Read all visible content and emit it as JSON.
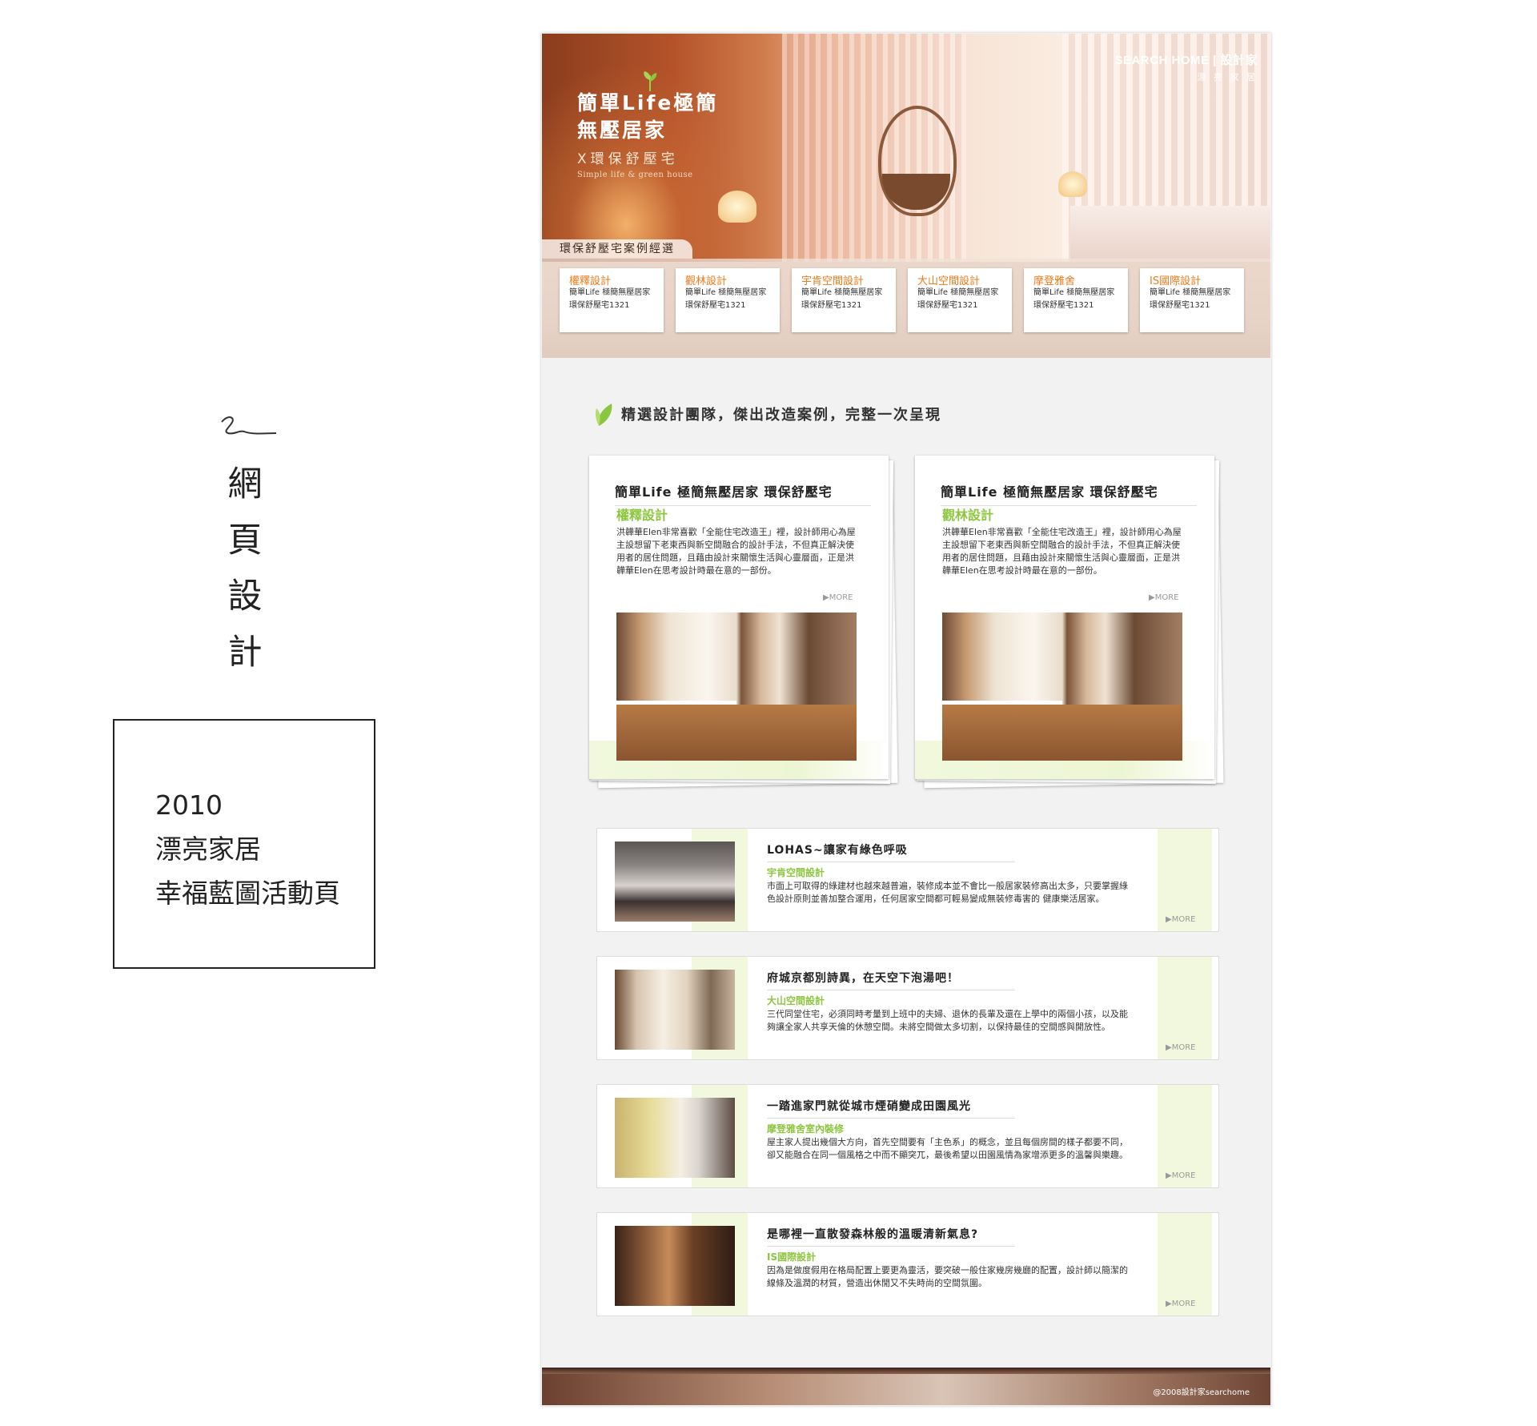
{
  "annotation": {
    "title_chars": [
      "網",
      "頁",
      "設",
      "計"
    ],
    "info_lines": [
      "2010",
      "漂亮家居",
      "幸福藍圖活動頁"
    ]
  },
  "banner": {
    "brand_line1": "SEARCH HOME | 設計家",
    "brand_line2": "漂 亮 家 居",
    "headline_line1": "簡單Life極簡",
    "headline_line2": "無壓居家",
    "headline_line3": "X環保舒壓宅",
    "headline_line4": "Simple life & green house",
    "section_tab": "環保舒壓宅案例經選"
  },
  "designers": [
    {
      "name": "權釋設計",
      "text": "簡單Life 極簡無壓居家 環保舒壓宅1321"
    },
    {
      "name": "觀林設計",
      "text": "簡單Life 極簡無壓居家 環保舒壓宅1321"
    },
    {
      "name": "宇肯空間設計",
      "text": "簡單Life 極簡無壓居家 環保舒壓宅1321"
    },
    {
      "name": "大山空間設計",
      "text": "簡單Life 極簡無壓居家 環保舒壓宅1321"
    },
    {
      "name": "摩登雅舍",
      "text": "簡單Life 極簡無壓居家 環保舒壓宅1321"
    },
    {
      "name": "IS國際設計",
      "text": "簡單Life 極簡無壓居家 環保舒壓宅1321"
    }
  ],
  "section_heading": "精選設計團隊，傑出改造案例，完整一次呈現",
  "features": [
    {
      "title": "簡單Life 極簡無壓居家 環保舒壓宅",
      "designer": "權釋設計",
      "text": "洪韡華Elen非常喜歡「全能住宅改造王」裡，設計師用心為屋主設想留下老東西與新空間融合的設計手法，不但真正解決使用者的居住問題，且藉由設計來關懷生活與心靈層面，正是洪韡華Elen在思考設計時最在意的一部份。",
      "more": "MORE"
    },
    {
      "title": "簡單Life 極簡無壓居家 環保舒壓宅",
      "designer": "觀林設計",
      "text": "洪韡華Elen非常喜歡「全能住宅改造王」裡，設計師用心為屋主設想留下老東西與新空間融合的設計手法，不但真正解決使用者的居住問題，且藉由設計來關懷生活與心靈層面，正是洪韡華Elen在思考設計時最在意的一部份。",
      "more": "MORE"
    }
  ],
  "articles": [
    {
      "title": "LOHAS~讓家有綠色呼吸",
      "designer": "宇肯空間設計",
      "text": "市面上可取得的綠建材也越來越普遍，裝修成本並不會比一般居家裝修高出太多，只要掌握綠色設計原則並善加整合運用，任何居家空間都可輕易變成無裝修毒害的 健康樂活居家。",
      "more": "MORE"
    },
    {
      "title": "府城京都別詩異，在天空下泡湯吧！",
      "designer": "大山空間設計",
      "text": "三代同堂住宅，必須同時考量到上班中的夫婦、退休的長輩及還在上學中的兩個小孩，以及能夠讓全家人共享天倫的休憩空間。未將空間做太多切割，以保持最佳的空間感與開放性。",
      "more": "MORE"
    },
    {
      "title": "一踏進家門就從城市煙硝變成田園風光",
      "designer": "摩登雅舍室內裝修",
      "text": "屋主家人提出幾個大方向，首先空間要有「主色系」的概念，並且每個房間的樣子都要不同，卻又能融合在同一個風格之中而不顯突兀，最後希望以田園風情為家增添更多的溫馨與樂趣。",
      "more": "MORE"
    },
    {
      "title": "是哪裡一直散發森林般的溫暖清新氣息?",
      "designer": "IS國際設計",
      "text": "因為是做度假用在格局配置上要更為靈活，要突破一般住家幾房幾廳的配置，設計師以簡潔的線條及溫潤的材質，營造出休閒又不失時尚的空間氛圍。",
      "more": "MORE"
    }
  ],
  "footer": {
    "copyright": "@2008設計家searchome"
  },
  "colors": {
    "accent_orange": "#ef7a1a",
    "accent_green": "#8cc63f",
    "light_green": "#f1f8dd"
  },
  "icons": [
    "leaf-icon",
    "play-arrow-icon"
  ]
}
